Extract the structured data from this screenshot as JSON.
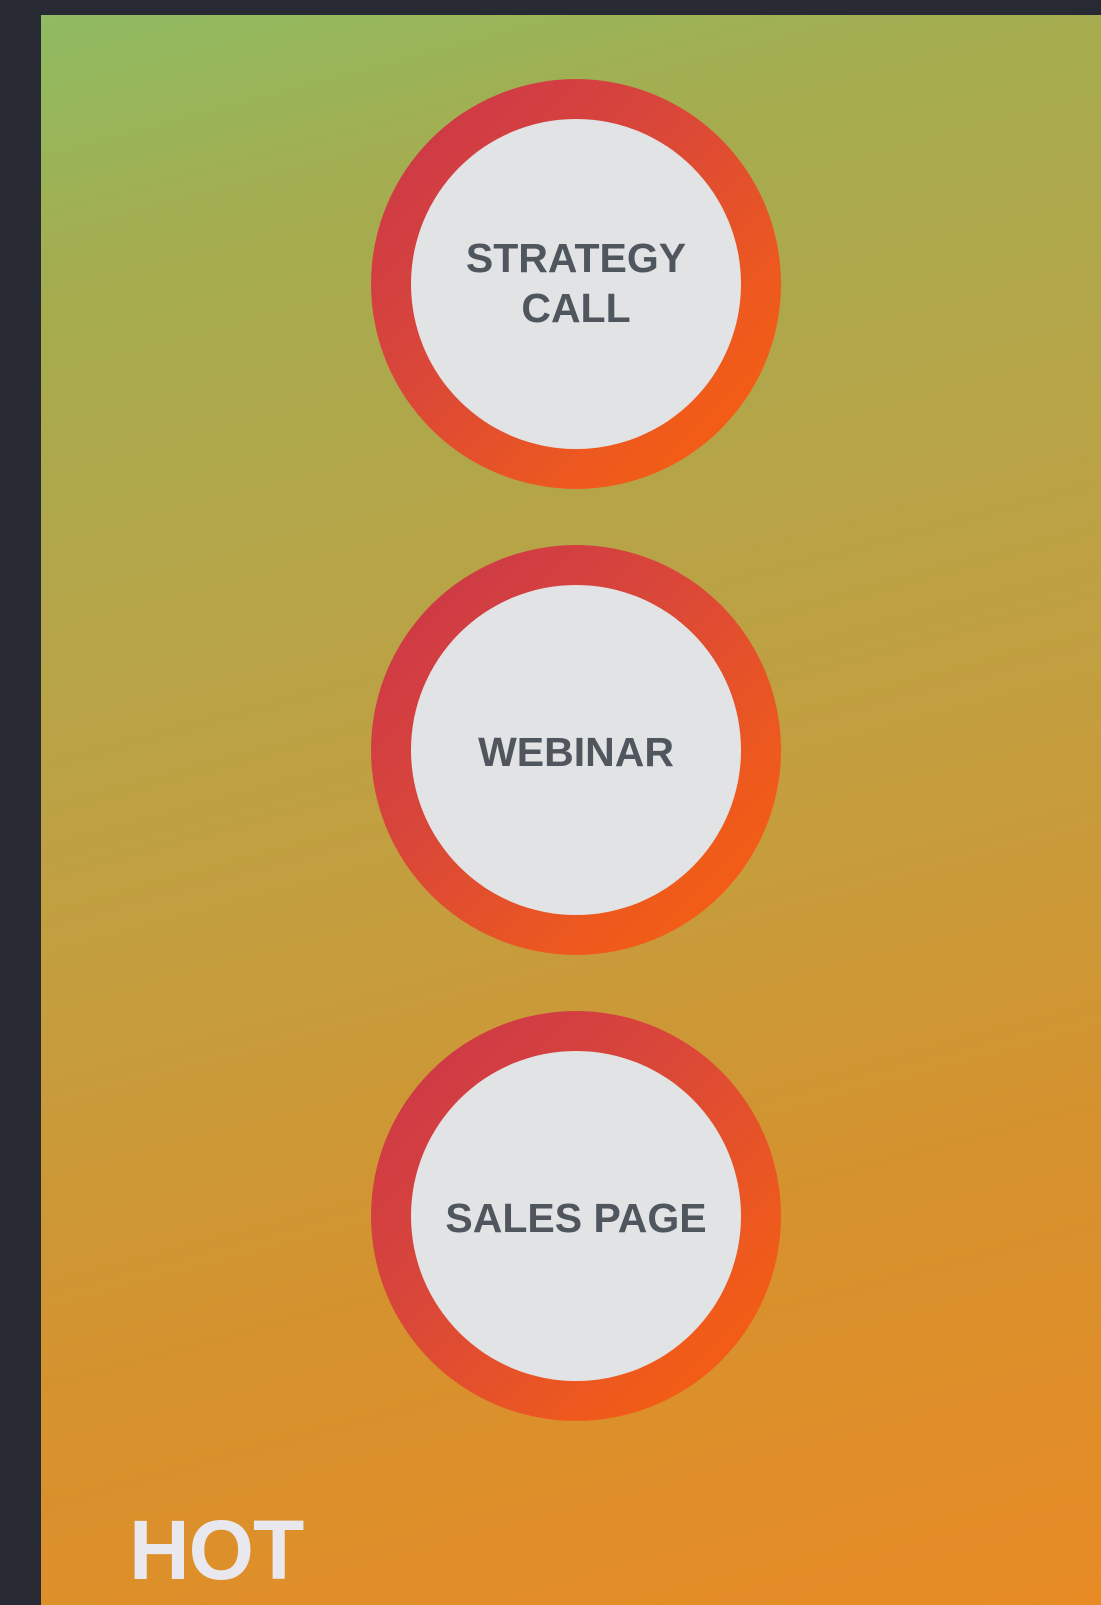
{
  "stages": [
    {
      "label": "STRATEGY\nCALL"
    },
    {
      "label": "WEBINAR"
    },
    {
      "label": "SALES PAGE"
    }
  ],
  "tier": {
    "label": "HOT"
  },
  "colors": {
    "background": "#272a33",
    "gradient_top": "#8fbb62",
    "gradient_bottom": "#e88b25",
    "ring_start": "#c9344a",
    "ring_end": "#f85f0a",
    "circle_fill": "#e2e3e5",
    "circle_text": "#4f565d",
    "tier_text": "#e9e8ee"
  }
}
